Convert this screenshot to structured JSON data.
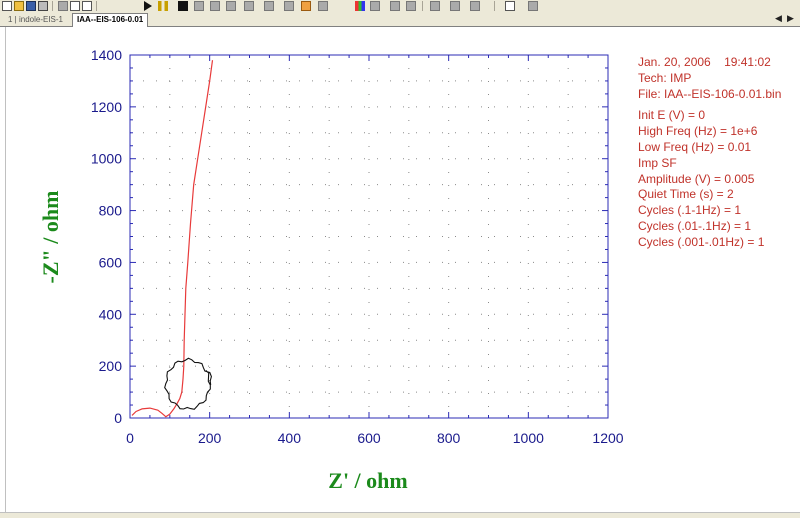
{
  "tabs": [
    {
      "label": "1 | indole-EIS-1",
      "active": false
    },
    {
      "label": "IAA--EIS-106-0.01",
      "active": true
    }
  ],
  "nav": {
    "prev": "◀",
    "next": "▶"
  },
  "toolbar_icons": [
    "new-file-icon",
    "open-folder-icon",
    "save-icon",
    "print-icon",
    "check-icon",
    "clipboard-icon",
    "copy-icon",
    "run-icon",
    "pause-icon",
    "stop-icon",
    "undo-icon",
    "redo-icon",
    "refresh-icon",
    "magic-icon",
    "gear-icon",
    "zoom-region-icon",
    "zoom-icon",
    "tripod-icon",
    "color-palette-icon",
    "data-icon",
    "layout-icon",
    "cut-icon",
    "line-icon",
    "marker-icon",
    "spreadsheet-icon",
    "help-pointer-icon"
  ],
  "info": {
    "date": "Jan. 20, 2006",
    "time": "19:41:02",
    "tech": "Tech: IMP",
    "file": "File: IAA--EIS-106-0.01.bin",
    "lines": [
      "Init E (V) = 0",
      "High Freq (Hz) = 1e+6",
      "Low Freq (Hz) = 0.01",
      "Imp SF",
      "Amplitude (V) = 0.005",
      "Quiet Time (s) = 2",
      "Cycles (.1-1Hz) = 1",
      "Cycles (.01-.1Hz) = 1",
      "Cycles (.001-.01Hz) = 1"
    ]
  },
  "chart_data": {
    "type": "line",
    "xlabel": "Z' / ohm",
    "ylabel": "-Z\" / ohm",
    "xlim": [
      0,
      1200
    ],
    "ylim": [
      0,
      1400
    ],
    "xticks": [
      "0",
      "200",
      "400",
      "600",
      "800",
      "1000",
      "1200"
    ],
    "yticks": [
      "0",
      "200",
      "400",
      "600",
      "800",
      "1000",
      "1200",
      "1400"
    ],
    "grid": "dotted",
    "series": [
      {
        "color": "#e83a3a",
        "x": [
          5,
          15,
          30,
          50,
          70,
          80,
          90,
          100,
          110,
          118,
          125,
          130,
          133,
          135,
          136,
          138,
          140,
          145,
          152,
          160,
          170,
          180,
          190,
          200,
          207
        ],
        "y": [
          10,
          25,
          35,
          38,
          30,
          18,
          5,
          15,
          35,
          55,
          75,
          100,
          150,
          200,
          300,
          400,
          500,
          600,
          750,
          900,
          1000,
          1100,
          1200,
          1300,
          1380
        ]
      }
    ],
    "annotation": {
      "type": "hand-drawn-circle",
      "color": "#111111",
      "center": [
        145,
        130
      ],
      "radius_x": 55,
      "radius_y": 95
    }
  }
}
